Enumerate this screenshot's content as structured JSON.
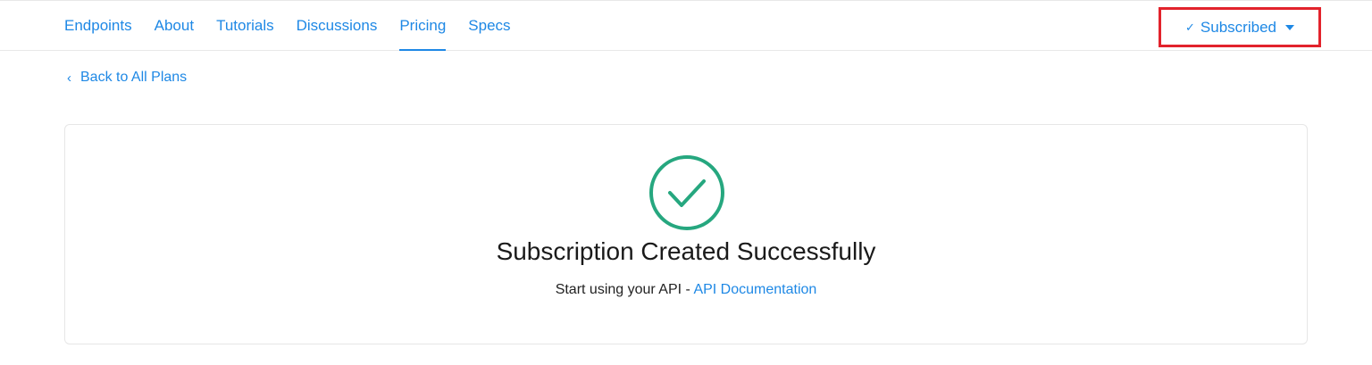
{
  "nav": {
    "tabs": [
      {
        "label": "Endpoints"
      },
      {
        "label": "About"
      },
      {
        "label": "Tutorials"
      },
      {
        "label": "Discussions"
      },
      {
        "label": "Pricing",
        "active": true
      },
      {
        "label": "Specs"
      }
    ],
    "subscribed_label": "Subscribed"
  },
  "back_link": "Back to All Plans",
  "card": {
    "title": "Subscription Created Successfully",
    "subtitle_prefix": "Start using your API - ",
    "doc_link": "API Documentation"
  },
  "colors": {
    "accent": "#1e88e5",
    "success": "#26a77f",
    "highlight_border": "#e2232c"
  }
}
